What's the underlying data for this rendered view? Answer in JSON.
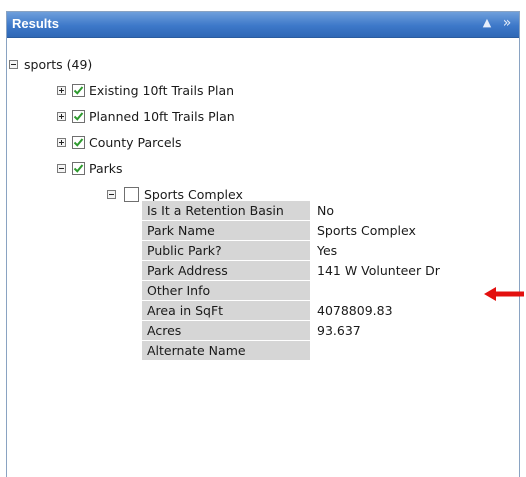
{
  "panel": {
    "title": "Results",
    "collapse_symbol": "▲",
    "expand_symbol": "»"
  },
  "tree": {
    "root": {
      "label": "sports (49)",
      "state": "expanded"
    },
    "layers": [
      {
        "label": "Existing 10ft Trails Plan",
        "checked": true,
        "state": "collapsed"
      },
      {
        "label": "Planned 10ft Trails Plan",
        "checked": true,
        "state": "collapsed"
      },
      {
        "label": "County Parcels",
        "checked": true,
        "state": "collapsed"
      },
      {
        "label": "Parks",
        "checked": true,
        "state": "expanded"
      }
    ],
    "feature": {
      "label": "Sports Complex",
      "checked": false,
      "state": "expanded"
    }
  },
  "attributes": [
    {
      "key": "Is It a Retention Basin",
      "value": "No"
    },
    {
      "key": "Park Name",
      "value": "Sports Complex"
    },
    {
      "key": "Public Park?",
      "value": "Yes"
    },
    {
      "key": "Park Address",
      "value": "141 W Volunteer Dr"
    },
    {
      "key": "Other Info",
      "value": ""
    },
    {
      "key": "Area in SqFt",
      "value": "4078809.83"
    },
    {
      "key": "Acres",
      "value": "93.637"
    },
    {
      "key": "Alternate Name",
      "value": ""
    }
  ],
  "colors": {
    "titlebar": "#3d78c9",
    "check": "#2e9a2e",
    "key_cell": "#d6d6d6",
    "arrow": "#e3100f"
  },
  "annotation": {
    "icon": "red-arrow-icon"
  }
}
